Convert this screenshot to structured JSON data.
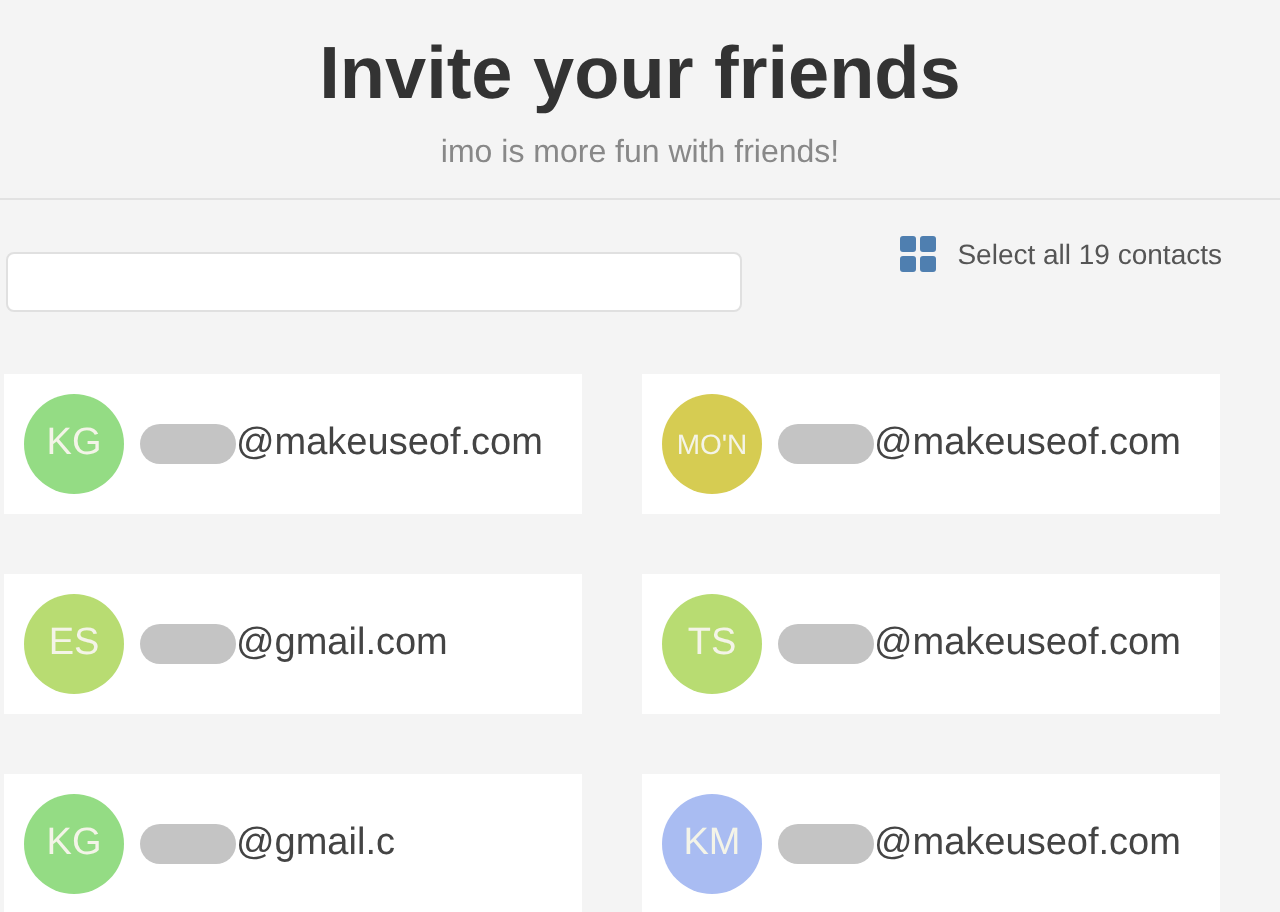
{
  "header": {
    "title": "Invite your friends",
    "subtitle": "imo is more fun with friends!"
  },
  "select_all": {
    "label": "Select all 19 contacts"
  },
  "contacts": [
    {
      "initials": "KG",
      "color": "#94dc84",
      "redacted": true,
      "email": "@makeuseof.com"
    },
    {
      "initials": "MO'N",
      "color": "#d6cc52",
      "redacted": true,
      "email": "@makeuseof.com"
    },
    {
      "initials": "ES",
      "color": "#b8dc72",
      "redacted": true,
      "email": "@gmail.com"
    },
    {
      "initials": "TS",
      "color": "#b8dc72",
      "redacted": true,
      "email": "@makeuseof.com"
    },
    {
      "initials": "KG",
      "color": "#94dc84",
      "redacted": true,
      "email": "@gmail.c"
    },
    {
      "initials": "KM",
      "color": "#a9bcf2",
      "redacted": true,
      "email": "@makeuseof.com"
    }
  ]
}
